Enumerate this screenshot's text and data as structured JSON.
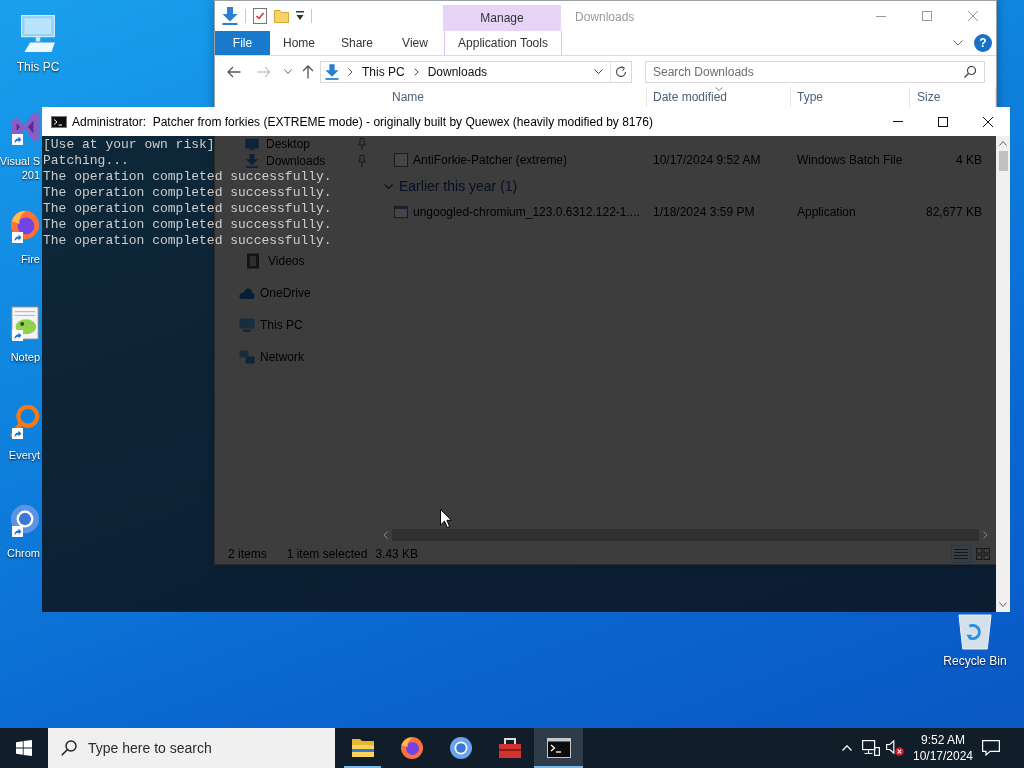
{
  "desktop": {
    "icons": [
      {
        "kind": "pc",
        "label_lines": [
          "This PC"
        ],
        "shortcut": false
      },
      {
        "kind": "visual-studio",
        "label_lines": [
          "Visual S",
          "201"
        ],
        "shortcut": true
      },
      {
        "kind": "firefox",
        "label_lines": [
          "Fire"
        ],
        "shortcut": true
      },
      {
        "kind": "notepad",
        "label_lines": [
          "Notep"
        ],
        "shortcut": true
      },
      {
        "kind": "everything",
        "label_lines": [
          "Everyt"
        ],
        "shortcut": true
      },
      {
        "kind": "chromium",
        "label_lines": [
          "Chrom"
        ],
        "shortcut": true
      }
    ],
    "recycle_bin": {
      "label": "Recycle Bin"
    }
  },
  "explorer": {
    "context_header": "Manage",
    "title": "Downloads",
    "tabs": [
      {
        "label": "File",
        "kind": "file",
        "selected": false
      },
      {
        "label": "Home",
        "kind": "tab",
        "selected": false
      },
      {
        "label": "Share",
        "kind": "tab",
        "selected": false
      },
      {
        "label": "View",
        "kind": "tab",
        "selected": false
      },
      {
        "label": "Application Tools",
        "kind": "context",
        "selected": false
      }
    ],
    "help": "?",
    "address": [
      "This PC",
      "Downloads"
    ],
    "search": {
      "placeholder": "Search Downloads"
    },
    "columns": [
      {
        "label": "Name",
        "sorted": false
      },
      {
        "label": "Date modified",
        "sorted": true
      },
      {
        "label": "Type",
        "sorted": false
      },
      {
        "label": "Size",
        "sorted": false
      }
    ],
    "nav": [
      {
        "children": [
          {
            "label": "Desktop",
            "kind": "desktop",
            "pinned": true
          },
          {
            "label": "Downloads",
            "kind": "downloads",
            "pinned": true
          },
          {
            "label": "Videos",
            "kind": "videos",
            "pinned": false
          }
        ]
      },
      {
        "label": "OneDrive",
        "kind": "onedrive",
        "pinned": false
      },
      {
        "label": "This PC",
        "kind": "pc",
        "pinned": false
      },
      {
        "label": "Network",
        "kind": "network",
        "pinned": false
      }
    ],
    "rows": [
      {
        "kind": "script",
        "name": "AntiForkie-Patcher (extreme)",
        "modified": "10/17/2024 9:52 AM",
        "type": "Windows Batch File",
        "size": "4 KB"
      },
      {
        "kind": "group",
        "label": "Earlier this year (1)",
        "expanded": true
      },
      {
        "kind": "application",
        "name": "ungoogled-chromium_123.0.6312.122-1....",
        "modified": "1/18/2024 3:59 PM",
        "type": "Application",
        "size": "82,677 KB"
      }
    ],
    "status": {
      "count": "2 items",
      "selection": "1 item selected",
      "selection_size": "3.43 KB"
    },
    "view_buttons": [
      {
        "kind": "details",
        "selected": true
      },
      {
        "kind": "large-icons",
        "selected": false
      }
    ]
  },
  "console": {
    "title": "Administrator:  Patcher from forkies (EXTREME mode) - originally built by Quewex (heavily modified by 8176)",
    "lines": [
      "[Use at your own risk]",
      "Patching...",
      "The operation completed successfully.",
      "The operation completed successfully.",
      "The operation completed successfully.",
      "The operation completed successfully.",
      "The operation completed successfully."
    ]
  },
  "taskbar": {
    "search_placeholder": "Type here to search",
    "apps": [
      {
        "kind": "explorer",
        "running": true,
        "active": false
      },
      {
        "kind": "firefox",
        "running": false,
        "active": false
      },
      {
        "kind": "chromium",
        "running": false,
        "active": false
      },
      {
        "kind": "toolbox",
        "running": false,
        "active": false
      },
      {
        "kind": "terminal",
        "running": true,
        "active": true
      }
    ],
    "volume_muted": true,
    "clock": {
      "time": "9:52 AM",
      "date": "10/17/2024"
    }
  }
}
